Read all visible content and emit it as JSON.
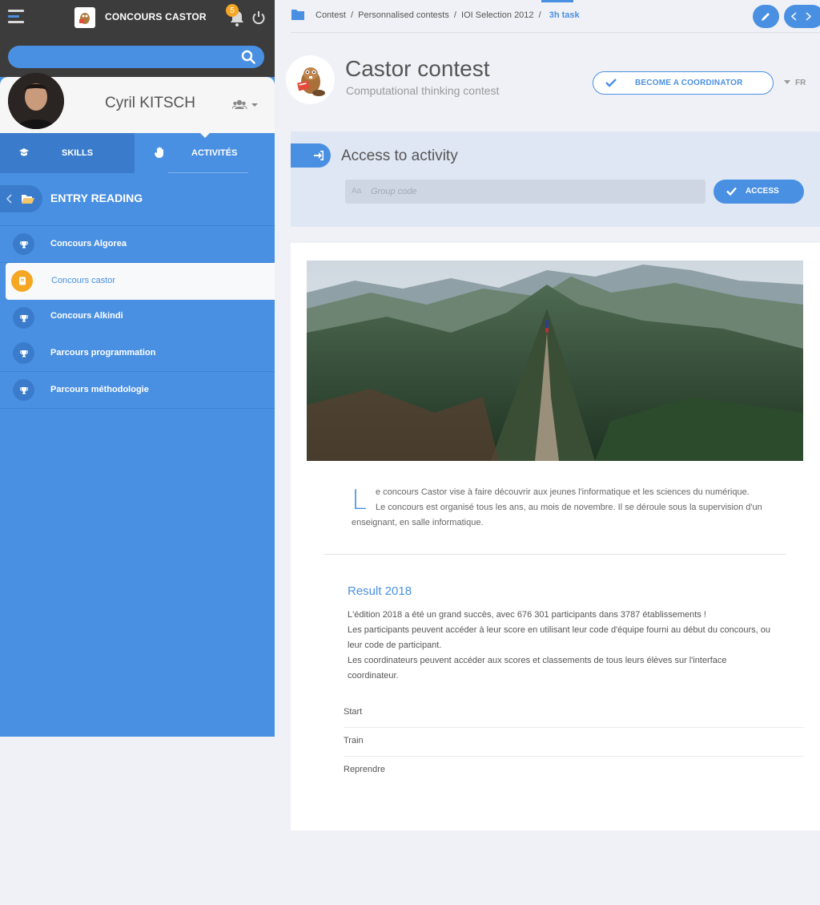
{
  "app": {
    "title": "CONCOURS CASTOR",
    "notifications_count": "5"
  },
  "search": {
    "placeholder": ""
  },
  "user": {
    "name": "Cyril KITSCH"
  },
  "tabs": [
    {
      "label": "SKILLS"
    },
    {
      "label": "ACTIVITÉS"
    }
  ],
  "entry": {
    "title": "ENTRY READING"
  },
  "menu": [
    {
      "label": "Concours Algorea",
      "icon": "trophy-icon"
    },
    {
      "label": "Concours castor",
      "icon": "book-icon"
    },
    {
      "label": "Concours Alkindi",
      "icon": "trophy-icon"
    },
    {
      "label": "Parcours programmation",
      "icon": "trophy-icon"
    },
    {
      "label": "Parcours méthodologie",
      "icon": "trophy-icon"
    }
  ],
  "breadcrumb": {
    "items": [
      "Contest",
      "Personnalised contests",
      "IOI Selection 2012"
    ],
    "current": "3h task",
    "separator": "/"
  },
  "contest": {
    "title": "Castor contest",
    "subtitle": "Computational thinking contest",
    "coordinator_label": "BECOME A COORDINATOR",
    "language": "FR"
  },
  "access": {
    "title": "Access to activity",
    "input_prefix": "Aa",
    "placeholder": "Group code",
    "button_label": "ACCESS"
  },
  "intro": {
    "dropcap": "L",
    "line1": "e concours Castor vise à faire découvrir aux jeunes l'informatique et les sciences du numérique.",
    "line2": "Le concours est organisé tous les ans, au mois de novembre. Il se déroule sous la supervision d'un",
    "line3": "enseignant, en salle informatique."
  },
  "result": {
    "title": "Result 2018",
    "line1": " L'édition 2018 a été un grand succès, avec 676 301 participants dans 3787 établissements !",
    "line2": "Les participants peuvent accéder à leur score en utilisant leur code d'équipe fourni au début du concours, ou",
    "line3": "leur code de participant.",
    "line4": "Les coordinateurs peuvent accéder aux scores et classements de tous leurs élèves sur l'interface",
    "line5": "coordinateur."
  },
  "actions": [
    {
      "label": "Start"
    },
    {
      "label": "Train"
    },
    {
      "label": "Reprendre"
    }
  ],
  "colors": {
    "accent": "#4a90e2",
    "dark_bar": "#3c3c3c",
    "highlight": "#f5a623"
  }
}
